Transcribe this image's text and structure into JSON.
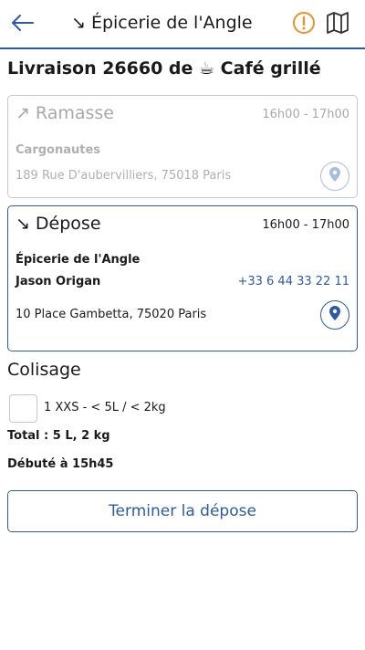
{
  "header": {
    "title": "↘ Épicerie de l'Angle",
    "back_icon": "arrow-left-icon",
    "alert_icon": "alert-circle-icon",
    "map_icon": "map-icon",
    "accent_color": "#2d5aa8",
    "alert_color": "#f0902c"
  },
  "delivery": {
    "title": "Livraison 26660 de ☕ Café grillé"
  },
  "pickup": {
    "arrow": "↗",
    "label": "Ramasse",
    "time": "16h00 - 17h00",
    "organization": "Cargonautes",
    "address": "189 Rue D'aubervilliers, 75018 Paris",
    "pin_icon": "location-pin-icon",
    "state": "disabled"
  },
  "dropoff": {
    "arrow": "↘",
    "label": "Dépose",
    "time": "16h00 - 17h00",
    "organization": "Épicerie de l'Angle",
    "contact": "Jason Origan",
    "phone": "+33 6 44 33 22 11",
    "address": "10 Place Gambetta, 75020 Paris",
    "pin_icon": "location-pin-icon",
    "state": "active"
  },
  "packaging": {
    "title": "Colisage",
    "items": [
      {
        "label": "1 XXS - < 5L / < 2kg",
        "checked": false
      }
    ],
    "total": "Total : 5 L, 2 kg",
    "started": "Débuté à 15h45"
  },
  "actions": {
    "finish_label": "Terminer la dépose"
  }
}
